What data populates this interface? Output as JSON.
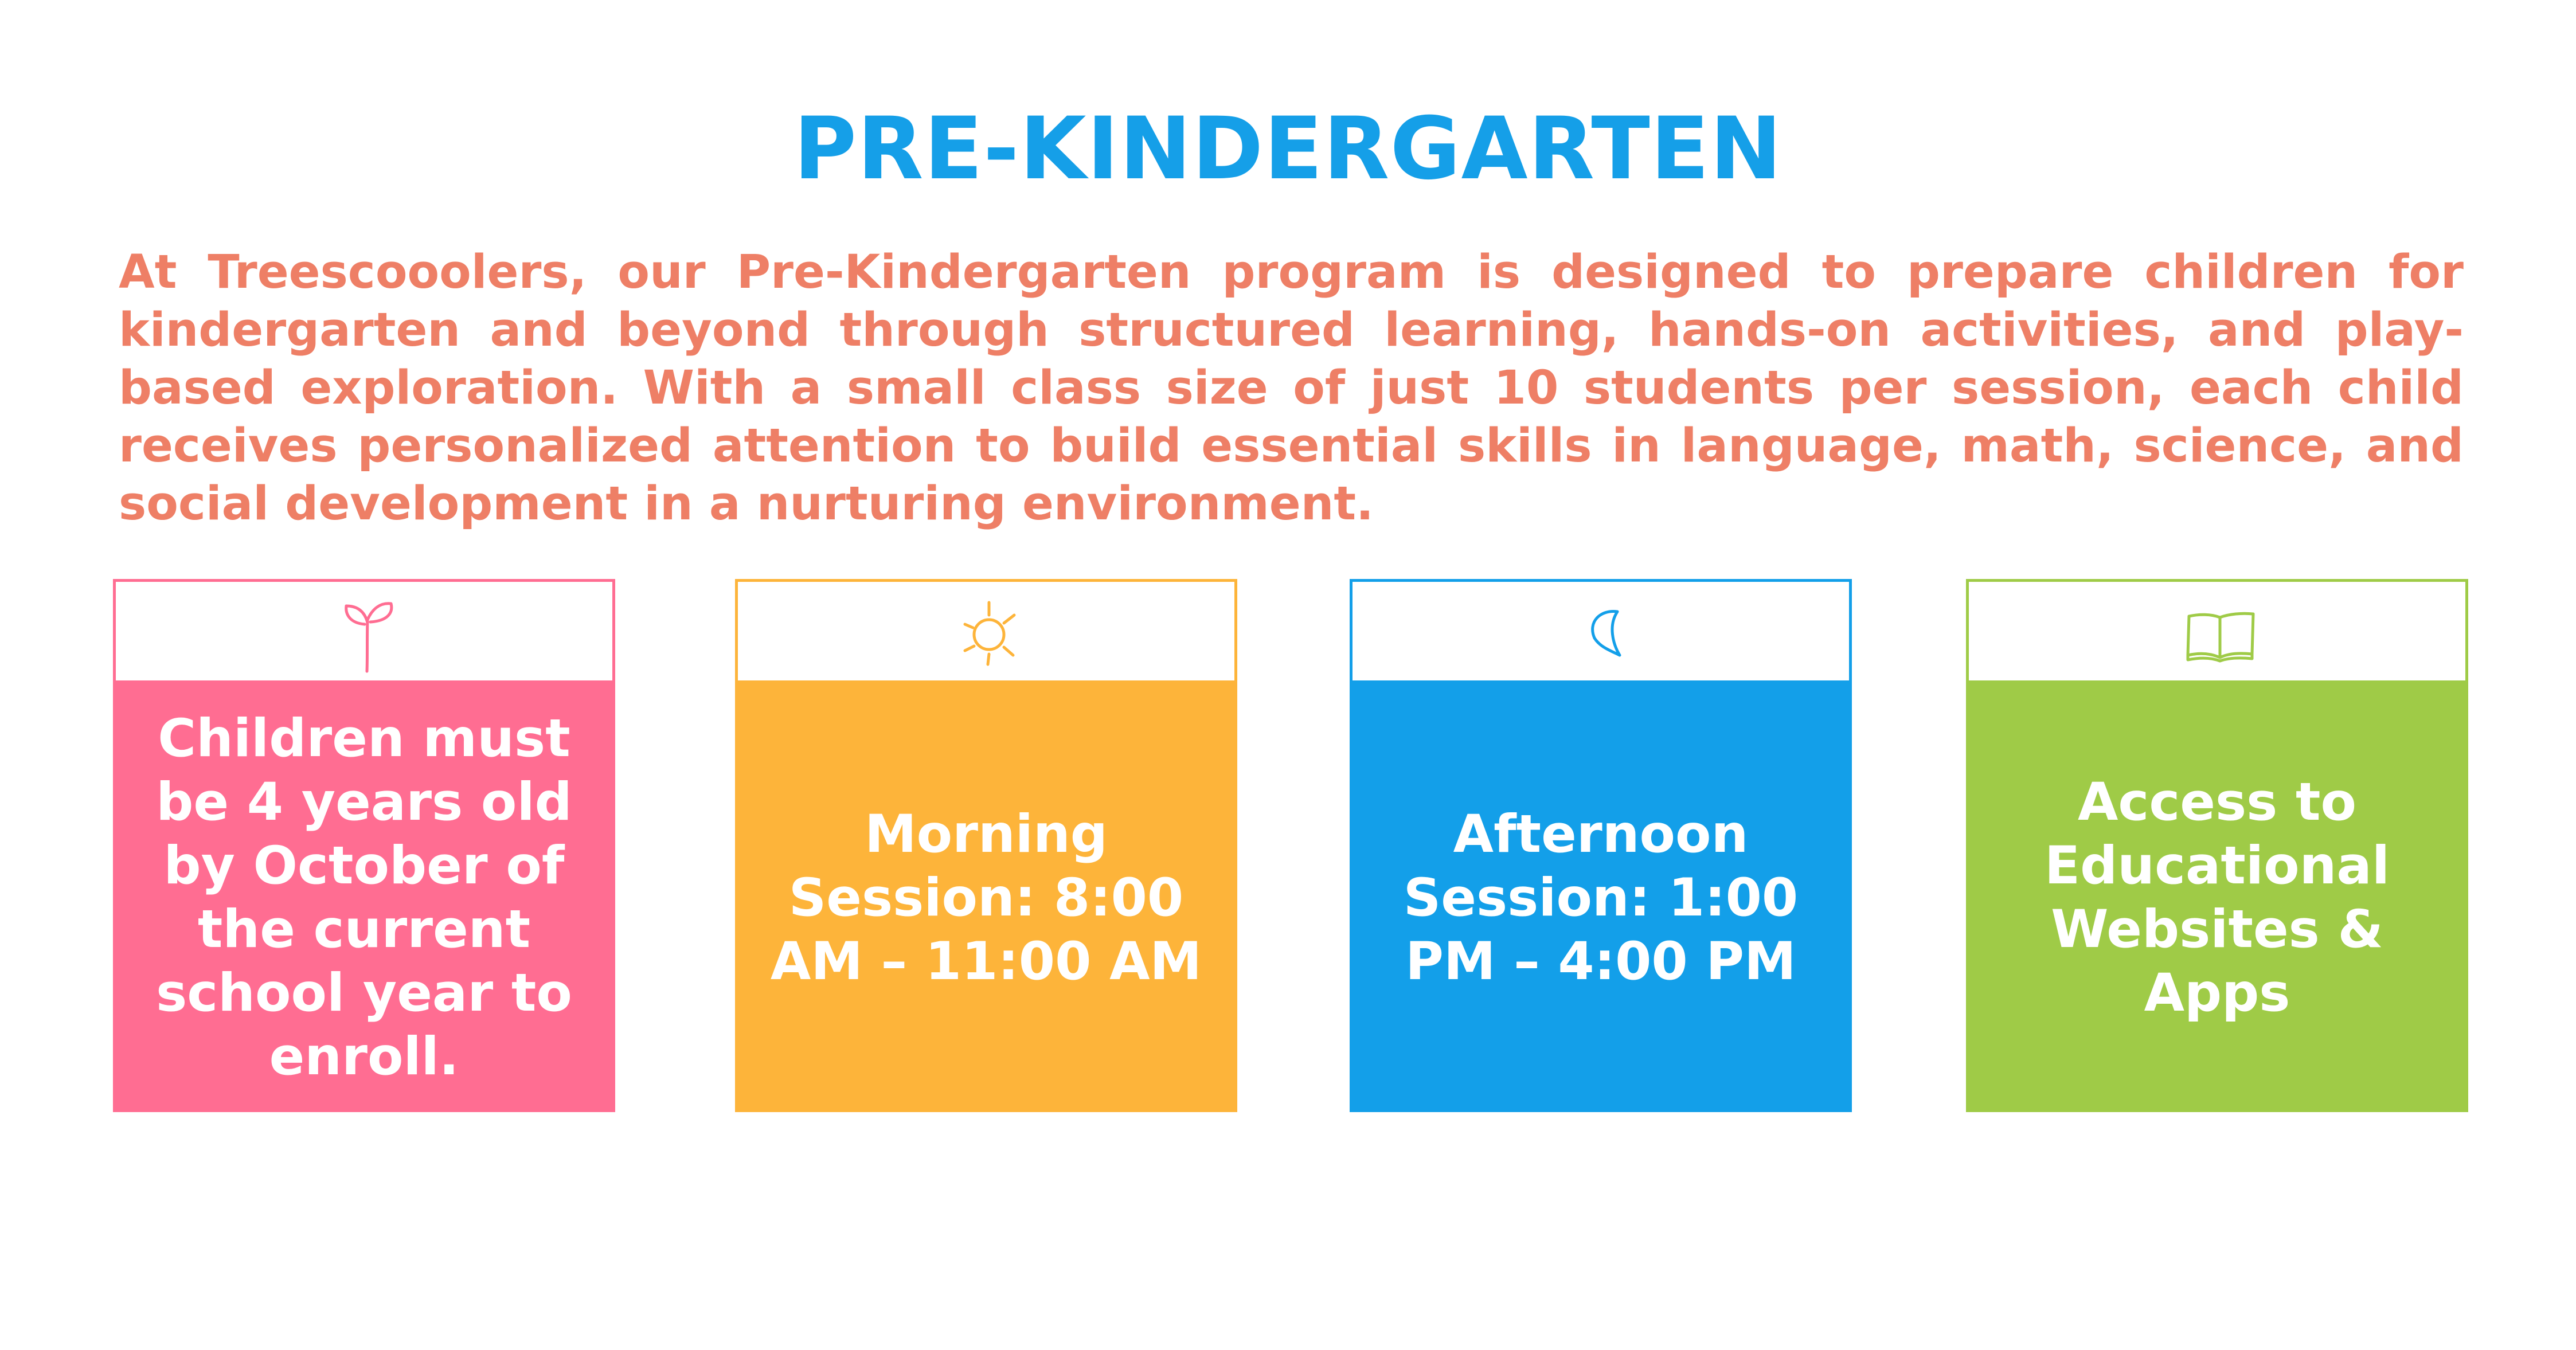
{
  "page": {
    "title": "PRE-KINDERGARTEN",
    "intro": "At Treescooolers, our Pre-Kindergarten program is designed to prepare children for kindergarten and beyond through structured learning, hands-on activities, and play-based exploration. With a small class size of just 10 students per session, each child receives personalized attention to build essential skills in language, math, science, and social development in a nurturing environment."
  },
  "colors": {
    "title": "#159FE8",
    "intro": "#EE7F66",
    "pink": "#FF6D92",
    "orange": "#FDB43A",
    "blue": "#139FE9",
    "green": "#9FCB47"
  },
  "cards": [
    {
      "icon": "sprout-icon",
      "text": "Children must be 4 years old by October of the current school year to enroll."
    },
    {
      "icon": "sun-icon",
      "text": "Morning Session: 8:00 AM – 11:00 AM"
    },
    {
      "icon": "crescent-moon-icon",
      "text": "Afternoon Session: 1:00 PM – 4:00 PM"
    },
    {
      "icon": "open-book-icon",
      "text": "Access to Educational Websites & Apps"
    }
  ]
}
